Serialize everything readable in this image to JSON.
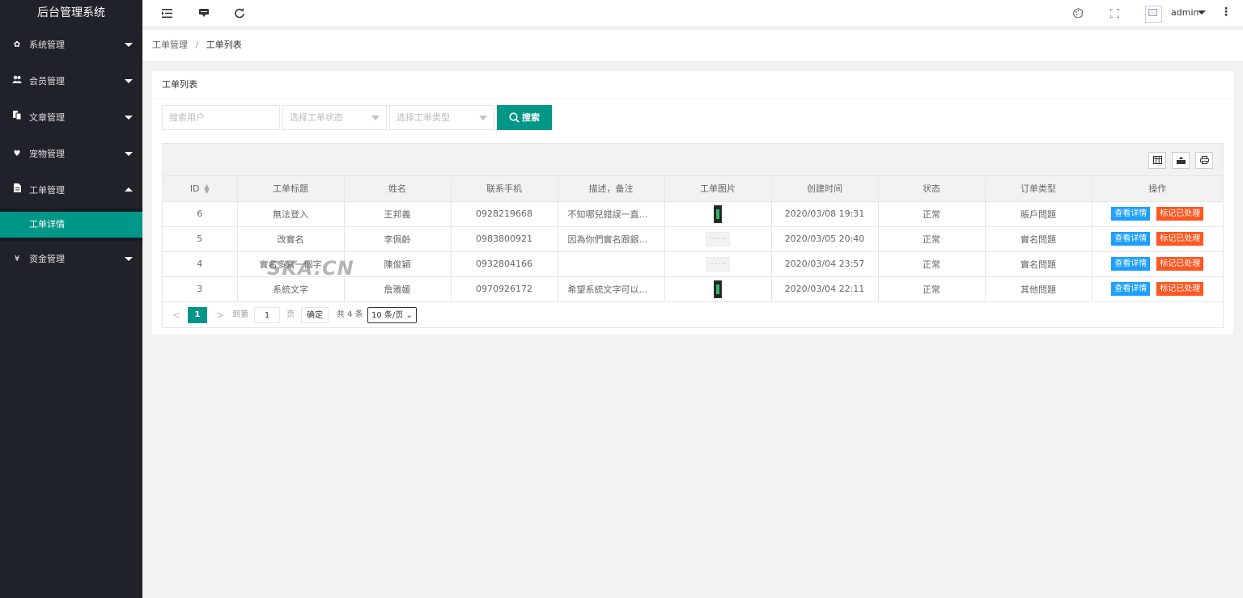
{
  "app": {
    "title": "后台管理系统"
  },
  "sidebar": {
    "items": [
      {
        "label": "系统管理",
        "icon": "gear-icon"
      },
      {
        "label": "会员管理",
        "icon": "users-icon"
      },
      {
        "label": "文章管理",
        "icon": "article-icon"
      },
      {
        "label": "宠物管理",
        "icon": "heart-icon"
      },
      {
        "label": "工单管理",
        "icon": "document-icon",
        "expanded": true,
        "children": [
          {
            "label": "工单详情",
            "active": true
          }
        ]
      },
      {
        "label": "资金管理",
        "icon": "yen-icon"
      }
    ]
  },
  "header": {
    "icons": [
      "menu-toggle-icon",
      "message-icon",
      "refresh-icon",
      "theme-icon",
      "fullscreen-icon",
      "more-icon"
    ],
    "user": {
      "name": "admin"
    }
  },
  "breadcrumb": {
    "items": [
      "工单管理",
      "工单列表"
    ]
  },
  "card": {
    "title": "工单列表",
    "filters": {
      "user_placeholder": "搜索用户",
      "status_placeholder": "选择工单状态",
      "type_placeholder": "选择工单类型",
      "search_label": "搜索"
    },
    "table": {
      "columns": [
        "ID",
        "工单标题",
        "姓名",
        "联系手机",
        "描述，备注",
        "工单图片",
        "创建时间",
        "状态",
        "订单类型",
        "操作"
      ],
      "rows": [
        {
          "id": "6",
          "title": "無法登入",
          "name": "王邦義",
          "phone": "0928219668",
          "desc": "不知哪兒錯誤一直…",
          "image": "phone-screenshot",
          "created": "2020/03/08 19:31",
          "status": "正常",
          "type": "賬戶問題"
        },
        {
          "id": "5",
          "title": "改實名",
          "name": "李佩齡",
          "phone": "0983800921",
          "desc": "因為你們實名跟銀…",
          "image": "broken-image",
          "created": "2020/03/05 20:40",
          "status": "正常",
          "type": "實名問題"
        },
        {
          "id": "4",
          "title": "實名多寫一個字",
          "name": "陳俊穎",
          "phone": "0932804166",
          "desc": "",
          "image": "broken-image",
          "created": "2020/03/04 23:57",
          "status": "正常",
          "type": "實名問題"
        },
        {
          "id": "3",
          "title": "系統文字",
          "name": "詹雅媛",
          "phone": "0970926172",
          "desc": "希望系統文字可以…",
          "image": "phone-screenshot",
          "created": "2020/03/04 22:11",
          "status": "正常",
          "type": "其他問題"
        }
      ],
      "actions": {
        "detail": "查看详情",
        "mark": "标记已处理"
      }
    },
    "pagination": {
      "current": "1",
      "goto_label": "到第",
      "goto_value": "1",
      "page_label": "页",
      "confirm": "确定",
      "total": "共 4 条",
      "page_size": "10 条/页"
    }
  },
  "watermark": "SKA.CN",
  "colors": {
    "sidebar_bg": "#20222a",
    "accent": "#009688",
    "detail_btn": "#1e9fff",
    "mark_btn": "#ff5722"
  }
}
